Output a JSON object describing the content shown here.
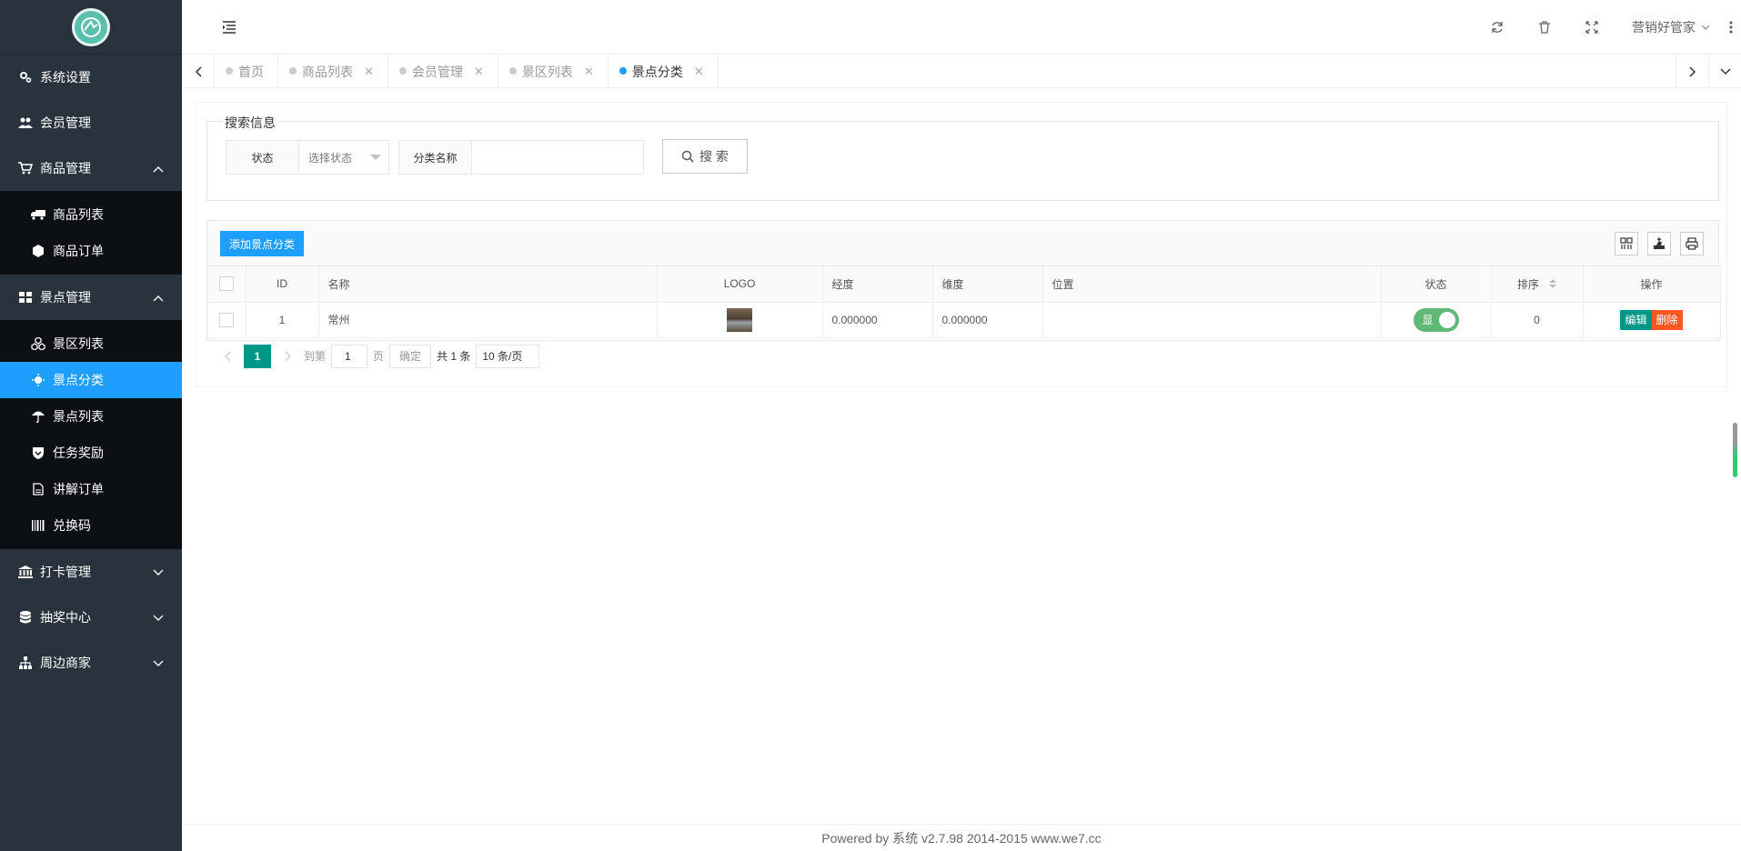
{
  "sidebar": {
    "items": [
      {
        "label": "系统设置",
        "icon": "gears-icon"
      },
      {
        "label": "会员管理",
        "icon": "users-icon"
      },
      {
        "label": "商品管理",
        "icon": "cart-icon",
        "children": [
          {
            "label": "商品列表",
            "icon": "truck-icon"
          },
          {
            "label": "商品订单",
            "icon": "cube-icon"
          }
        ]
      },
      {
        "label": "景点管理",
        "icon": "grid-icon",
        "children": [
          {
            "label": "景区列表",
            "icon": "cubes-icon"
          },
          {
            "label": "景点分类",
            "icon": "sun-icon",
            "active": true
          },
          {
            "label": "景点列表",
            "icon": "umbrella-icon"
          },
          {
            "label": "任务奖励",
            "icon": "shield-icon"
          },
          {
            "label": "讲解订单",
            "icon": "file-icon"
          },
          {
            "label": "兑换码",
            "icon": "barcode-icon"
          }
        ]
      },
      {
        "label": "打卡管理",
        "icon": "bank-icon"
      },
      {
        "label": "抽奖中心",
        "icon": "database-icon"
      },
      {
        "label": "周边商家",
        "icon": "sitemap-icon"
      }
    ]
  },
  "header": {
    "user": "营销好管家"
  },
  "tabs": [
    {
      "label": "首页",
      "closable": false
    },
    {
      "label": "商品列表",
      "closable": true
    },
    {
      "label": "会员管理",
      "closable": true
    },
    {
      "label": "景区列表",
      "closable": true
    },
    {
      "label": "景点分类",
      "closable": true,
      "active": true
    }
  ],
  "search": {
    "legend": "搜索信息",
    "status_label": "状态",
    "status_placeholder": "选择状态",
    "name_label": "分类名称",
    "name_value": "",
    "search_button": "搜 索"
  },
  "table": {
    "add_button": "添加景点分类",
    "columns": [
      "ID",
      "名称",
      "LOGO",
      "经度",
      "维度",
      "位置",
      "状态",
      "排序",
      "操作"
    ],
    "rows": [
      {
        "id": "1",
        "name": "常州",
        "lng": "0.000000",
        "lat": "0.000000",
        "location": "",
        "status": "显",
        "sort": "0",
        "edit": "编辑",
        "delete": "删除"
      }
    ]
  },
  "pager": {
    "current": "1",
    "goto_label": "到第",
    "page_input": "1",
    "page_unit": "页",
    "confirm": "确定",
    "total": "共 1 条",
    "page_size": "10 条/页"
  },
  "footer": "Powered by 系统 v2.7.98 2014-2015 www.we7.cc",
  "colors": {
    "sidebar_bg": "#28333e",
    "submenu_bg": "#0c0f13",
    "active": "#1e9fff",
    "page_current": "#009688",
    "edit": "#009688",
    "delete": "#ff5722",
    "switch_on": "#5fb878"
  }
}
